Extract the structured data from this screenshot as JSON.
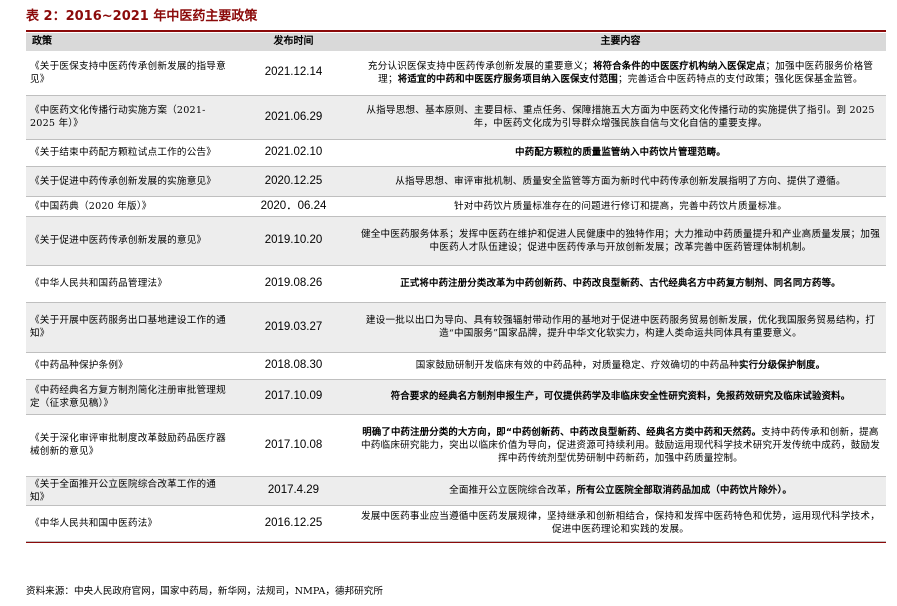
{
  "title": "表 2：2016~2021 年中医药主要政策",
  "headers": {
    "policy": "政策",
    "date": "发布时间",
    "content": "主要内容"
  },
  "rows": [
    {
      "policy": "《关于医保支持中医药传承创新发展的指导意见》",
      "date": "2021.12.14",
      "content": [
        {
          "t": "充分认识医保支持中医药传承创新发展的重要意义；",
          "b": false
        },
        {
          "t": "将符合条件的中医医疗机构纳入医保定点",
          "b": true
        },
        {
          "t": "；加强中医药服务价格管理；",
          "b": false
        },
        {
          "t": "将适宜的中药和中医医疗服务项目纳入医保支付范围",
          "b": true
        },
        {
          "t": "；完善适合中医药特点的支付政策；强化医保基金监管。",
          "b": false
        }
      ]
    },
    {
      "policy": "《中医药文化传播行动实施方案（2021-2025 年）》",
      "date": "2021.06.29",
      "content": [
        {
          "t": "从指导思想、基本原则、主要目标、重点任务、保障措施五大方面为中医药文化传播行动的实施提供了指引。到 2025 年，中医药文化成为引导群众增强民族自信与文化自信的重要支撑。",
          "b": false
        }
      ]
    },
    {
      "policy": "《关于结束中药配方颗粒试点工作的公告》",
      "date": "2021.02.10",
      "content": [
        {
          "t": "中药配方颗粒的质量监管纳入中药饮片管理范畴。",
          "b": true
        }
      ]
    },
    {
      "policy": "《关于促进中药传承创新发展的实施意见》",
      "date": "2020.12.25",
      "content": [
        {
          "t": "从指导思想、审评审批机制、质量安全监管等方面为新时代中药传承创新发展指明了方向、提供了遵循。",
          "b": false
        }
      ]
    },
    {
      "policy": "《中国药典（2020 年版）》",
      "date": "2020．06.24",
      "content": [
        {
          "t": "针对中药饮片质量标准存在的问题进行修订和提高，完善中药饮片质量标准。",
          "b": false
        }
      ]
    },
    {
      "policy": "《关于促进中医药传承创新发展的意见》",
      "date": "2019.10.20",
      "content": [
        {
          "t": "健全中医药服务体系；发挥中医药在维护和促进人民健康中的独特作用；大力推动中药质量提升和产业高质量发展；加强中医药人才队伍建设；促进中医药传承与开放创新发展；改革完善中医药管理体制机制。",
          "b": false
        }
      ]
    },
    {
      "policy": "《中华人民共和国药品管理法》",
      "date": "2019.08.26",
      "content": [
        {
          "t": "正式将中药注册分类改革为中药创新药、中药改良型新药、古代经典名方中药复方制剂、同名同方药等。",
          "b": true
        }
      ]
    },
    {
      "policy": "《关于开展中医药服务出口基地建设工作的通知》",
      "date": "2019.03.27",
      "content": [
        {
          "t": "建设一批以出口为导向、具有较强辐射带动作用的基地对于促进中医药服务贸易创新发展，优化我国服务贸易结构，打造“中国服务”国家品牌，提升中华文化软实力，构建人类命运共同体具有重要意义。",
          "b": false
        }
      ]
    },
    {
      "policy": "《中药品种保护条例》",
      "date": "2018.08.30",
      "content": [
        {
          "t": "国家鼓励研制开发临床有效的中药品种，对质量稳定、疗效确切的中药品种",
          "b": false
        },
        {
          "t": "实行分级保护制度。",
          "b": true
        }
      ]
    },
    {
      "policy": "《中药经典名方复方制剂简化注册审批管理规定（征求意见稿）》",
      "date": "2017.10.09",
      "content": [
        {
          "t": "符合要求的经典名方制剂申报生产，可仅提供药学及非临床安全性研究资料，免报药效研究及临床试验资料。",
          "b": true
        }
      ]
    },
    {
      "policy": "《关于深化审评审批制度改革鼓励药品医疗器械创新的意见》",
      "date": "2017.10.08",
      "content": [
        {
          "t": "明确了中药注册分类的大方向，即“中药创新药、中药改良型新药、经典名方类中药和天然药。",
          "b": true
        },
        {
          "t": "支持中药传承和创新，提高中药临床研究能力，突出以临床价值为导向，促进资源可持续利用。鼓励运用现代科学技术研究开发传统中成药，鼓励发挥中药传统剂型优势研制中药新药，加强中药质量控制。",
          "b": false
        }
      ]
    },
    {
      "policy": "《关于全面推开公立医院综合改革工作的通知》",
      "date": "2017.4.29",
      "content": [
        {
          "t": "全面推开公立医院综合改革，",
          "b": false
        },
        {
          "t": "所有公立医院全部取消药品加成（中药饮片除外）。",
          "b": true
        }
      ]
    },
    {
      "policy": "《中华人民共和国中医药法》",
      "date": "2016.12.25",
      "content": [
        {
          "t": "发展中医药事业应当遵循中医药发展规律，坚持继承和创新相结合，保持和发挥中医药特色和优势，运用现代科学技术，促进中医药理论和实践的发展。",
          "b": false
        }
      ]
    }
  ],
  "source": "资料来源：中央人民政府官网，国家中药局，新华网，法规司，NMPA，德邦研究所",
  "colors": {
    "title": "#8B0A0A",
    "header_bg": "#D9D9D9",
    "alt_row_bg": "#EDEDED"
  }
}
